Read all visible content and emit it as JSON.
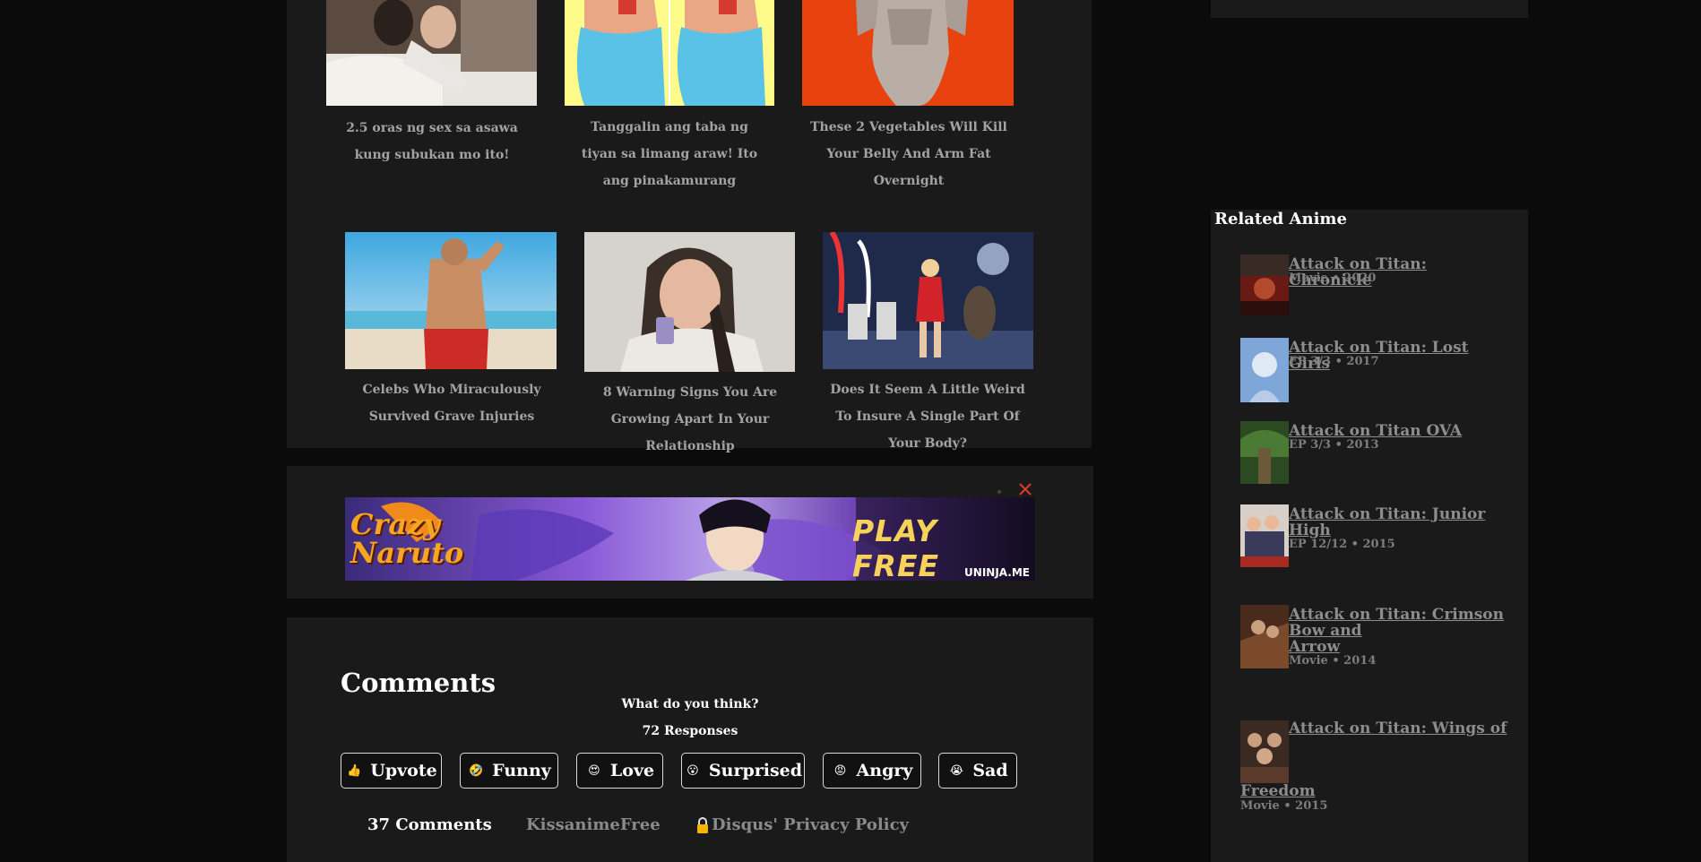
{
  "recommended": [
    {
      "caption": "2.5 oras ng sex sa asawa kung subukan mo ito!"
    },
    {
      "caption": "Tanggalin ang taba ng tiyan sa limang araw! Ito ang pinakamurang"
    },
    {
      "caption": "These 2 Vegetables Will Kill Your Belly And Arm Fat Overnight"
    },
    {
      "caption": "Celebs Who Miraculously Survived Grave Injuries"
    },
    {
      "caption": "8 Warning Signs You Are Growing Apart In Your Relationship"
    },
    {
      "caption": "Does It Seem A Little Weird To Insure A Single Part Of Your Body?"
    }
  ],
  "ad": {
    "brand": "Crazy Naruto",
    "cta": "PLAY FREE",
    "domain": "UNINJA.ME",
    "close_icon": "close-icon",
    "close_color": "#e8382a"
  },
  "comments": {
    "heading": "Comments",
    "prompt": "What do you think?",
    "responses": "72 Responses",
    "reactions": [
      {
        "label": "Upvote",
        "icon": "thumbs-up-icon",
        "glyph": "👍"
      },
      {
        "label": "Funny",
        "icon": "laughing-face-icon",
        "glyph": "🤣"
      },
      {
        "label": "Love",
        "icon": "heart-eyes-face-icon",
        "glyph": "😍"
      },
      {
        "label": "Surprised",
        "icon": "surprised-face-icon",
        "glyph": "😮"
      },
      {
        "label": "Angry",
        "icon": "angry-face-icon",
        "glyph": "😡"
      },
      {
        "label": "Sad",
        "icon": "crying-face-icon",
        "glyph": "😭"
      }
    ],
    "tabs": {
      "count": "37 Comments",
      "site": "KissanimeFree",
      "privacy": "Disqus' Privacy Policy",
      "privacy_icon": "lock-icon"
    }
  },
  "related": {
    "heading": "Related Anime",
    "items": [
      {
        "title": "Attack on Titan: Chronicle",
        "meta": "Movie • 2020"
      },
      {
        "title": "Attack on Titan: Lost Girls",
        "meta": "EP 3/3 • 2017"
      },
      {
        "title": "Attack on Titan OVA",
        "meta": "EP 3/3 • 2013"
      },
      {
        "title_line1": "Attack on Titan: Junior",
        "title_line2": "High",
        "meta": "EP 12/12 • 2015"
      },
      {
        "title_line1": "Attack on Titan: Crimson",
        "title_line2": "Bow and",
        "title_line3": "Arrow",
        "meta": "Movie • 2014"
      },
      {
        "title_line1": "Attack on Titan: Wings of",
        "title_line2": "Freedom",
        "meta": "Movie • 2015"
      }
    ]
  },
  "colors": {
    "page_bg": "#0b0b0b",
    "panel_bg": "#1a1a1a",
    "caption": "#a3a3a3",
    "link": "#8d8d8d"
  }
}
